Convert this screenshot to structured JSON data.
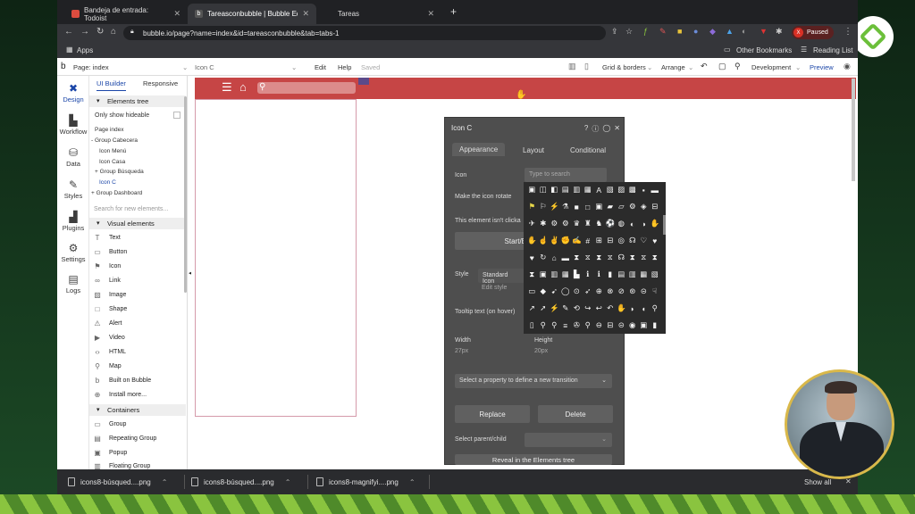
{
  "browser": {
    "tabs": [
      {
        "label": "Bandeja de entrada: Todoist",
        "active": false
      },
      {
        "label": "Tareasconbubble | Bubble Edit",
        "active": true
      },
      {
        "label": "Tareas",
        "active": false
      }
    ],
    "url": "bubble.io/page?name=index&id=tareasconbubble&tab=tabs-1",
    "profile_status": "Paused",
    "profile_initial": "X",
    "bookmarks": {
      "apps": "Apps",
      "other": "Other Bookmarks",
      "reading": "Reading List"
    }
  },
  "editor": {
    "page_label": "Page: index",
    "selected_element": "Icon C",
    "menu": {
      "edit": "Edit",
      "help": "Help",
      "saved": "Saved"
    },
    "grid_borders": "Grid & borders",
    "arrange": "Arrange",
    "development": "Development",
    "preview": "Preview"
  },
  "left_nav": [
    {
      "name": "design",
      "label": "Design",
      "icon": "design-icon"
    },
    {
      "name": "workflow",
      "label": "Workflow",
      "icon": "workflow-icon"
    },
    {
      "name": "data",
      "label": "Data",
      "icon": "data-icon"
    },
    {
      "name": "styles",
      "label": "Styles",
      "icon": "styles-icon"
    },
    {
      "name": "plugins",
      "label": "Plugins",
      "icon": "plugins-icon"
    },
    {
      "name": "settings",
      "label": "Settings",
      "icon": "settings-icon"
    },
    {
      "name": "logs",
      "label": "Logs",
      "icon": "logs-icon"
    }
  ],
  "panel": {
    "tab_ui": "UI Builder",
    "tab_responsive": "Responsive",
    "elements_tree": "Elements tree",
    "only_hideable": "Only show hideable",
    "tree": [
      "Page index",
      "- Group Cabecera",
      "Icon Menú",
      "Icon Casa",
      "+ Group Búsqueda",
      "Icon C",
      "+ Group Dashboard"
    ],
    "search_placeholder": "Search for new elements...",
    "visual_elements": "Visual elements",
    "visual_items": [
      "Text",
      "Button",
      "Icon",
      "Link",
      "Image",
      "Shape",
      "Alert",
      "Video",
      "HTML",
      "Map",
      "Built on Bubble",
      "Install more..."
    ],
    "containers": "Containers",
    "container_items": [
      "Group",
      "Repeating Group",
      "Popup",
      "Floating Group"
    ]
  },
  "property_editor": {
    "title": "Icon C",
    "tabs": [
      "Appearance",
      "Layout",
      "Conditional"
    ],
    "icon_label": "Icon",
    "icon_placeholder": "Type to search",
    "rotate_label": "Make the icon rotate",
    "clickable_label": "This element isn't clicka",
    "start_button": "Start/E",
    "style_label": "Style",
    "style_value": "Standard Icon",
    "edit_style": "Edit style",
    "tooltip_label": "Tooltip text (on hover)",
    "width_label": "Width",
    "width_value": "27px",
    "height_label": "Height",
    "height_value": "20px",
    "transition_placeholder": "Select a property to define a new transition",
    "replace": "Replace",
    "delete": "Delete",
    "parent_child": "Select parent/child",
    "reveal": "Reveal in the Elements tree"
  },
  "icon_picker_rows": [
    [
      "▣",
      "◫",
      "◧",
      "▤",
      "▥",
      "▦",
      "A",
      "▧",
      "▨",
      "▩",
      "▪",
      "▬"
    ],
    [
      "⚑",
      "⚐",
      "⚡",
      "⚗",
      "■",
      "□",
      "▣",
      "▰",
      "▱",
      "⚙",
      "◈",
      "⊟"
    ],
    [
      "✈",
      "✱",
      "⚙",
      "⚙",
      "♛",
      "♜",
      "♞",
      "⚽",
      "◍",
      "◐",
      "◑",
      "✋"
    ],
    [
      "✋",
      "☝",
      "✌",
      "✊",
      "✍",
      "#",
      "⊞",
      "⊟",
      "◎",
      "☊",
      "♡",
      "♥"
    ],
    [
      "♥",
      "↻",
      "⌂",
      "▬",
      "⧗",
      "⧖",
      "⧗",
      "⧖",
      "☊",
      "⧗",
      "⧖",
      "⧗"
    ],
    [
      "⧗",
      "▣",
      "▥",
      "▦",
      "▙",
      "ℹ",
      "ℹ",
      "▮",
      "▤",
      "▥",
      "▦",
      "▧"
    ],
    [
      "▭",
      "◆",
      "➹",
      "◯",
      "⊙",
      "➶",
      "⊕",
      "⊗",
      "⊘",
      "⊛",
      "⊝",
      "☟"
    ],
    [
      "↗",
      "➚",
      "⚡",
      "✎",
      "⟲",
      "↪",
      "↩",
      "↶",
      "✋",
      "◗",
      "◖",
      "⚲"
    ],
    [
      "▯",
      "⚲",
      "⚲",
      "≡",
      "✇",
      "⚲",
      "⊖",
      "⊟",
      "⊝",
      "◉",
      "▣",
      "▮"
    ]
  ],
  "downloads": {
    "files": [
      "icons8-búsqued....png",
      "icons8-búsqued....png",
      "icons8-magnifyi....png"
    ],
    "show_all": "Show all"
  },
  "colors": {
    "bubble_header": "#c64545",
    "accent_blue": "#1b46a8",
    "frame_green": "#6bbf3a"
  }
}
